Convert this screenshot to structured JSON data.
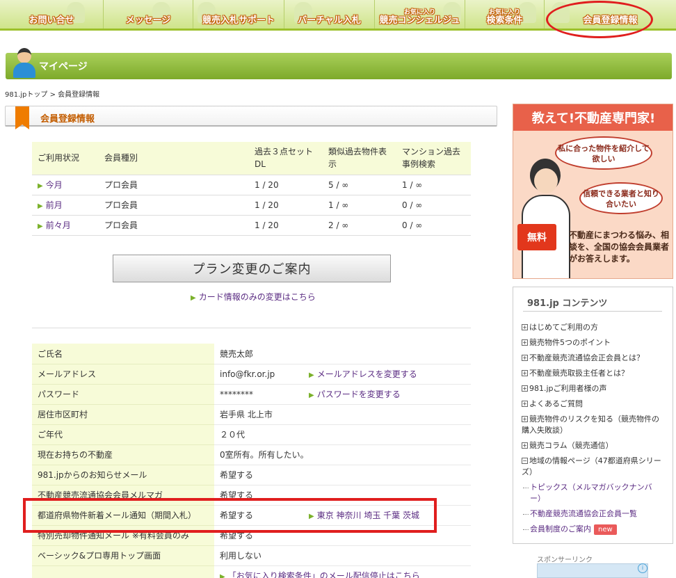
{
  "nav": {
    "items": [
      {
        "label": "お問い合せ",
        "small": ""
      },
      {
        "label": "メッセージ",
        "small": ""
      },
      {
        "label": "競売入札サポート",
        "small": ""
      },
      {
        "label": "バーチャル入札",
        "small": ""
      },
      {
        "label": "競売コンシェルジュ",
        "small": "お気に入り"
      },
      {
        "label": "検索条件",
        "small": "お気に入り"
      },
      {
        "label": "会員登録情報",
        "small": ""
      }
    ]
  },
  "mypage": {
    "title": "マイページ"
  },
  "breadcrumb": "981.jpトップ > 会員登録情報",
  "section": {
    "title": "会員登録情報"
  },
  "usage": {
    "headers": [
      "ご利用状況",
      "会員種別",
      "過去３点セットDL",
      "類似過去物件表示",
      "マンション過去事例検索"
    ],
    "rows": [
      {
        "period": "今月",
        "type": "プロ会員",
        "dl": "1 / 20",
        "similar": "5 / ∞",
        "mansion": "1 / ∞"
      },
      {
        "period": "前月",
        "type": "プロ会員",
        "dl": "1 / 20",
        "similar": "1 / ∞",
        "mansion": "0 / ∞"
      },
      {
        "period": "前々月",
        "type": "プロ会員",
        "dl": "1 / 20",
        "similar": "2 / ∞",
        "mansion": "0 / ∞"
      }
    ]
  },
  "plan_button": "プラン変更のご案内",
  "card_link": "カード情報のみの変更はこちら",
  "info": [
    {
      "key": "ご氏名",
      "value": "競売太郎",
      "action": ""
    },
    {
      "key": "メールアドレス",
      "value": "info@fkr.or.jp",
      "action": "メールアドレスを変更する"
    },
    {
      "key": "パスワード",
      "value": "********",
      "action": "パスワードを変更する"
    },
    {
      "key": "居住市区町村",
      "value": "岩手県 北上市",
      "action": ""
    },
    {
      "key": "ご年代",
      "value": "２０代",
      "action": ""
    },
    {
      "key": "現在お持ちの不動産",
      "value": "0室所有。所有したい。",
      "action": ""
    },
    {
      "key": "981.jpからのお知らせメール",
      "value": "希望する",
      "action": ""
    },
    {
      "key": "不動産競売流通協会会員メルマガ",
      "value": "希望する",
      "action": ""
    },
    {
      "key": "都道府県物件新着メール通知（期間入札）",
      "value": "希望する",
      "action": "東京 神奈川 埼玉 千葉 茨城"
    },
    {
      "key": "特別売却物件通知メール ※有料会員のみ",
      "value": "希望する",
      "action": ""
    },
    {
      "key": "ベーシック&プロ専用トップ画面",
      "value": "利用しない",
      "action": ""
    },
    {
      "key": "",
      "value": "",
      "action": "「お気に入り検索条件」のメール配信停止はこちら"
    }
  ],
  "ad": {
    "heading": "教えて!不動産専門家!",
    "bubble1": "私に合った物件を紹介して欲しい",
    "bubble2": "信頼できる業者と知り合いたい",
    "free": "無料",
    "desc": "不動産にまつわる悩み、相談を、全国の協会会員業者がお答えします。"
  },
  "contents": {
    "title": "981.jp コンテンツ",
    "items": [
      "はじめてご利用の方",
      "競売物件5つのポイント",
      "不動産競売流通協会正会員とは？",
      "不動産競売取扱主任者とは？",
      "981.jpご利用者様の声",
      "よくあるご質問",
      "競売物件のリスクを知る（競売物件の購入失敗談）",
      "競売コラム（競売通信）",
      "地域の情報ページ（47都道府県シリーズ）"
    ],
    "subitems": [
      "トピックス（メルマガバックナンバー）",
      "不動産競売流通協会正会員一覧",
      "会員制度のご案内"
    ],
    "new_badge": "new"
  },
  "sponsor": {
    "label": "スポンサーリンク",
    "info_icon": "i"
  },
  "colors": {
    "nav_green": "#9cc12b",
    "accent_orange": "#ef7c00",
    "highlight_red": "#e01e1e",
    "link_purple": "#5a2b82"
  }
}
